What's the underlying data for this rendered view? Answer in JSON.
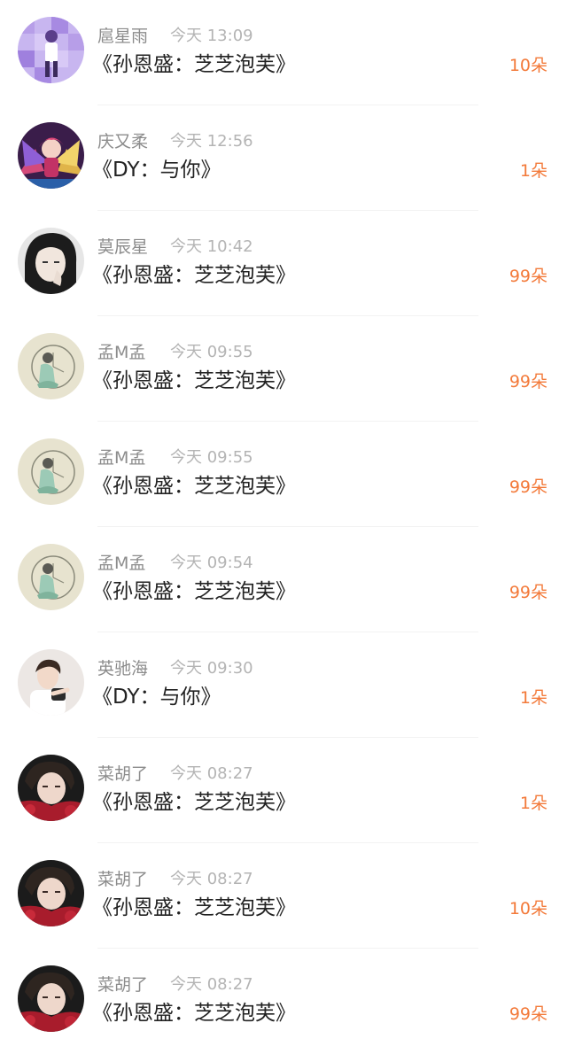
{
  "colors": {
    "name": "#8c8c8c",
    "time": "#b4b4b4",
    "song": "#222222",
    "gift": "#f37a3a",
    "divider": "#f2f2f2"
  },
  "items": [
    {
      "name": "扈星雨",
      "time": "今天 13:09",
      "song": "《孙恩盛：芝芝泡芙》",
      "gift": "10朵",
      "avatar": "avatar-purple-icon"
    },
    {
      "name": "庆又柔",
      "time": "今天 12:56",
      "song": "《DY：与你》",
      "gift": "1朵",
      "avatar": "avatar-anime-wings-icon"
    },
    {
      "name": "莫辰星",
      "time": "今天 10:42",
      "song": "《孙恩盛：芝芝泡芙》",
      "gift": "99朵",
      "avatar": "avatar-portrait-dark-icon"
    },
    {
      "name": "孟M孟",
      "time": "今天 09:55",
      "song": "《孙恩盛：芝芝泡芙》",
      "gift": "99朵",
      "avatar": "avatar-sketch-clock-icon"
    },
    {
      "name": "孟M孟",
      "time": "今天 09:55",
      "song": "《孙恩盛：芝芝泡芙》",
      "gift": "99朵",
      "avatar": "avatar-sketch-clock-icon"
    },
    {
      "name": "孟M孟",
      "time": "今天 09:54",
      "song": "《孙恩盛：芝芝泡芙》",
      "gift": "99朵",
      "avatar": "avatar-sketch-clock-icon"
    },
    {
      "name": "英驰海",
      "time": "今天 09:30",
      "song": "《DY：与你》",
      "gift": "1朵",
      "avatar": "avatar-portrait-light-icon"
    },
    {
      "name": "菜胡了",
      "time": "今天 08:27",
      "song": "《孙恩盛：芝芝泡芙》",
      "gift": "1朵",
      "avatar": "avatar-portrait-red-icon"
    },
    {
      "name": "菜胡了",
      "time": "今天 08:27",
      "song": "《孙恩盛：芝芝泡芙》",
      "gift": "10朵",
      "avatar": "avatar-portrait-red-icon"
    },
    {
      "name": "菜胡了",
      "time": "今天 08:27",
      "song": "《孙恩盛：芝芝泡芙》",
      "gift": "99朵",
      "avatar": "avatar-portrait-red-icon"
    }
  ]
}
